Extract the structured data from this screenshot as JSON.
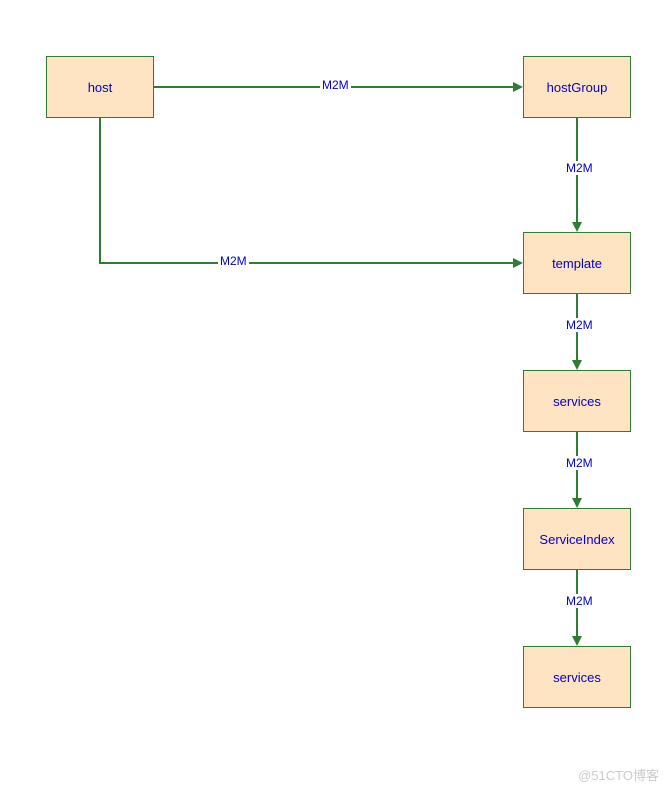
{
  "chart_data": {
    "type": "diagram",
    "nodes": [
      {
        "id": "host",
        "label": "host"
      },
      {
        "id": "hostGroup",
        "label": "hostGroup"
      },
      {
        "id": "template",
        "label": "template"
      },
      {
        "id": "services1",
        "label": "services"
      },
      {
        "id": "serviceIndex",
        "label": "ServiceIndex"
      },
      {
        "id": "services2",
        "label": "services"
      }
    ],
    "edges": [
      {
        "from": "host",
        "to": "hostGroup",
        "label": "M2M"
      },
      {
        "from": "host",
        "to": "template",
        "label": "M2M"
      },
      {
        "from": "hostGroup",
        "to": "template",
        "label": "M2M"
      },
      {
        "from": "template",
        "to": "services1",
        "label": "M2M"
      },
      {
        "from": "services1",
        "to": "serviceIndex",
        "label": "M2M"
      },
      {
        "from": "serviceIndex",
        "to": "services2",
        "label": "M2M"
      }
    ]
  },
  "nodes": {
    "host": "host",
    "hostGroup": "hostGroup",
    "template": "template",
    "services1": "services",
    "serviceIndex": "ServiceIndex",
    "services2": "services"
  },
  "edges": {
    "e1": "M2M",
    "e2": "M2M",
    "e3": "M2M",
    "e4": "M2M",
    "e5": "M2M",
    "e6": "M2M"
  },
  "watermark": "@51CTO博客"
}
